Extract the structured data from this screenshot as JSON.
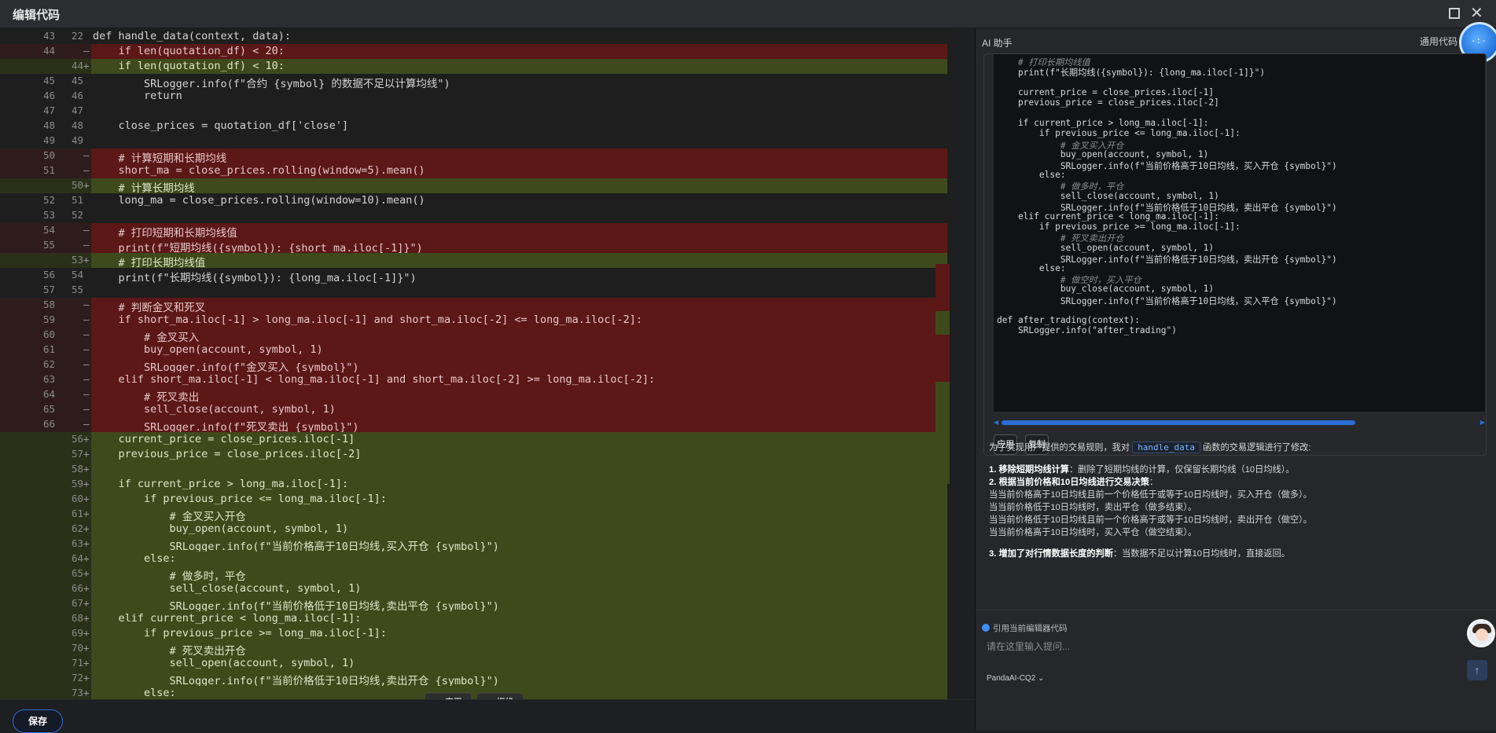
{
  "window": {
    "title": "编辑代码"
  },
  "editor": {
    "rows": [
      {
        "t": "ctx",
        "l1": "43",
        "l2": "22",
        "m": "",
        "c": "def handle_data(context, data):"
      },
      {
        "t": "del",
        "l1": "44",
        "l2": "",
        "m": "—",
        "c": "    if len(quotation_df) < 20:"
      },
      {
        "t": "add",
        "l1": "",
        "l2": "44",
        "m": "+",
        "c": "    if len(quotation_df) < 10:"
      },
      {
        "t": "ctx",
        "l1": "45",
        "l2": "45",
        "m": "",
        "c": "        SRLogger.info(f\"合约 {symbol} 的数据不足以计算均线\")"
      },
      {
        "t": "ctx",
        "l1": "46",
        "l2": "46",
        "m": "",
        "c": "        return"
      },
      {
        "t": "ctx",
        "l1": "47",
        "l2": "47",
        "m": "",
        "c": ""
      },
      {
        "t": "ctx",
        "l1": "48",
        "l2": "48",
        "m": "",
        "c": "    close_prices = quotation_df['close']"
      },
      {
        "t": "ctx",
        "l1": "49",
        "l2": "49",
        "m": "",
        "c": ""
      },
      {
        "t": "del",
        "l1": "50",
        "l2": "",
        "m": "—",
        "c": "    # 计算短期和长期均线"
      },
      {
        "t": "del",
        "l1": "51",
        "l2": "",
        "m": "—",
        "c": "    short_ma = close_prices.rolling(window=5).mean()"
      },
      {
        "t": "add",
        "l1": "",
        "l2": "50",
        "m": "+",
        "c": "    # 计算长期均线"
      },
      {
        "t": "ctx",
        "l1": "52",
        "l2": "51",
        "m": "",
        "c": "    long_ma = close_prices.rolling(window=10).mean()"
      },
      {
        "t": "ctx",
        "l1": "53",
        "l2": "52",
        "m": "",
        "c": ""
      },
      {
        "t": "del",
        "l1": "54",
        "l2": "",
        "m": "—",
        "c": "    # 打印短期和长期均线值"
      },
      {
        "t": "del",
        "l1": "55",
        "l2": "",
        "m": "—",
        "c": "    print(f\"短期均线({symbol}): {short_ma.iloc[-1]}\")"
      },
      {
        "t": "add",
        "l1": "",
        "l2": "53",
        "m": "+",
        "c": "    # 打印长期均线值"
      },
      {
        "t": "ctx",
        "l1": "56",
        "l2": "54",
        "m": "",
        "c": "    print(f\"长期均线({symbol}): {long_ma.iloc[-1]}\")"
      },
      {
        "t": "ctx",
        "l1": "57",
        "l2": "55",
        "m": "",
        "c": ""
      },
      {
        "t": "del",
        "l1": "58",
        "l2": "",
        "m": "—",
        "c": "    # 判断金叉和死叉"
      },
      {
        "t": "del",
        "l1": "59",
        "l2": "",
        "m": "—",
        "c": "    if short_ma.iloc[-1] > long_ma.iloc[-1] and short_ma.iloc[-2] <= long_ma.iloc[-2]:"
      },
      {
        "t": "del",
        "l1": "60",
        "l2": "",
        "m": "—",
        "c": "        # 金叉买入"
      },
      {
        "t": "del",
        "l1": "61",
        "l2": "",
        "m": "—",
        "c": "        buy_open(account, symbol, 1)"
      },
      {
        "t": "del",
        "l1": "62",
        "l2": "",
        "m": "—",
        "c": "        SRLogger.info(f\"金叉买入 {symbol}\")"
      },
      {
        "t": "del",
        "l1": "63",
        "l2": "",
        "m": "—",
        "c": "    elif short_ma.iloc[-1] < long_ma.iloc[-1] and short_ma.iloc[-2] >= long_ma.iloc[-2]:"
      },
      {
        "t": "del",
        "l1": "64",
        "l2": "",
        "m": "—",
        "c": "        # 死叉卖出"
      },
      {
        "t": "del",
        "l1": "65",
        "l2": "",
        "m": "—",
        "c": "        sell_close(account, symbol, 1)"
      },
      {
        "t": "del",
        "l1": "66",
        "l2": "",
        "m": "—",
        "c": "        SRLogger.info(f\"死叉卖出 {symbol}\")"
      },
      {
        "t": "add",
        "l1": "",
        "l2": "56",
        "m": "+",
        "c": "    current_price = close_prices.iloc[-1]"
      },
      {
        "t": "add",
        "l1": "",
        "l2": "57",
        "m": "+",
        "c": "    previous_price = close_prices.iloc[-2]"
      },
      {
        "t": "add",
        "l1": "",
        "l2": "58",
        "m": "+",
        "c": ""
      },
      {
        "t": "add",
        "l1": "",
        "l2": "59",
        "m": "+",
        "c": "    if current_price > long_ma.iloc[-1]:"
      },
      {
        "t": "add",
        "l1": "",
        "l2": "60",
        "m": "+",
        "c": "        if previous_price <= long_ma.iloc[-1]:"
      },
      {
        "t": "add",
        "l1": "",
        "l2": "61",
        "m": "+",
        "c": "            # 金叉买入开仓"
      },
      {
        "t": "add",
        "l1": "",
        "l2": "62",
        "m": "+",
        "c": "            buy_open(account, symbol, 1)"
      },
      {
        "t": "add",
        "l1": "",
        "l2": "63",
        "m": "+",
        "c": "            SRLogger.info(f\"当前价格高于10日均线,买入开仓 {symbol}\")"
      },
      {
        "t": "add",
        "l1": "",
        "l2": "64",
        "m": "+",
        "c": "        else:"
      },
      {
        "t": "add",
        "l1": "",
        "l2": "65",
        "m": "+",
        "c": "            # 做多时，平仓"
      },
      {
        "t": "add",
        "l1": "",
        "l2": "66",
        "m": "+",
        "c": "            sell_close(account, symbol, 1)"
      },
      {
        "t": "add",
        "l1": "",
        "l2": "67",
        "m": "+",
        "c": "            SRLogger.info(f\"当前价格低于10日均线,卖出平仓 {symbol}\")"
      },
      {
        "t": "add",
        "l1": "",
        "l2": "68",
        "m": "+",
        "c": "    elif current_price < long_ma.iloc[-1]:"
      },
      {
        "t": "add",
        "l1": "",
        "l2": "69",
        "m": "+",
        "c": "        if previous_price >= long_ma.iloc[-1]:"
      },
      {
        "t": "add",
        "l1": "",
        "l2": "70",
        "m": "+",
        "c": "            # 死叉卖出开仓"
      },
      {
        "t": "add",
        "l1": "",
        "l2": "71",
        "m": "+",
        "c": "            sell_open(account, symbol, 1)"
      },
      {
        "t": "add",
        "l1": "",
        "l2": "72",
        "m": "+",
        "c": "            SRLogger.info(f\"当前价格低于10日均线,卖出开仓 {symbol}\")"
      },
      {
        "t": "add",
        "l1": "",
        "l2": "73",
        "m": "+",
        "c": "        else:"
      }
    ],
    "accept_label": "✓ 应用",
    "reject_label": "✕ 拒绝"
  },
  "bottom": {
    "save_label": "保存"
  },
  "ai": {
    "title": "AI 助手",
    "header_right": "通用代码",
    "avatar_text": "-:-",
    "code_lines": [
      {
        "c": "    # 打印长期均线值",
        "k": "cmt"
      },
      {
        "c": "    print(f\"长期均线({symbol}): {long_ma.iloc[-1]}\")",
        "k": ""
      },
      {
        "c": "",
        "k": ""
      },
      {
        "c": "    current_price = close_prices.iloc[-1]",
        "k": ""
      },
      {
        "c": "    previous_price = close_prices.iloc[-2]",
        "k": ""
      },
      {
        "c": "",
        "k": ""
      },
      {
        "c": "    if current_price > long_ma.iloc[-1]:",
        "k": ""
      },
      {
        "c": "        if previous_price <= long_ma.iloc[-1]:",
        "k": ""
      },
      {
        "c": "            # 金叉买入开仓",
        "k": "cmt"
      },
      {
        "c": "            buy_open(account, symbol, 1)",
        "k": ""
      },
      {
        "c": "            SRLogger.info(f\"当前价格高于10日均线，买入开仓 {symbol}\")",
        "k": ""
      },
      {
        "c": "        else:",
        "k": ""
      },
      {
        "c": "            # 做多时，平仓",
        "k": "cmt"
      },
      {
        "c": "            sell_close(account, symbol, 1)",
        "k": ""
      },
      {
        "c": "            SRLogger.info(f\"当前价格低于10日均线，卖出平仓 {symbol}\")",
        "k": ""
      },
      {
        "c": "    elif current_price < long_ma.iloc[-1]:",
        "k": ""
      },
      {
        "c": "        if previous_price >= long_ma.iloc[-1]:",
        "k": ""
      },
      {
        "c": "            # 死叉卖出开仓",
        "k": "cmt"
      },
      {
        "c": "            sell_open(account, symbol, 1)",
        "k": ""
      },
      {
        "c": "            SRLogger.info(f\"当前价格低于10日均线，卖出开仓 {symbol}\")",
        "k": ""
      },
      {
        "c": "        else:",
        "k": ""
      },
      {
        "c": "            # 做空时，买入平仓",
        "k": "cmt"
      },
      {
        "c": "            buy_close(account, symbol, 1)",
        "k": ""
      },
      {
        "c": "            SRLogger.info(f\"当前价格高于10日均线，买入平仓 {symbol}\")",
        "k": ""
      },
      {
        "c": "",
        "k": ""
      },
      {
        "c": "def after_trading(context):",
        "k": ""
      },
      {
        "c": "    SRLogger.info(\"after_trading\")",
        "k": ""
      }
    ],
    "apply_label": "应用",
    "copy_label": "复制",
    "desc_intro_pre": "为了实现用户提供的交易规则，我对",
    "desc_tag": "handle_data",
    "desc_intro_post": "函数的交易逻辑进行了修改:",
    "desc_1_bold": "1. 移除短期均线计算",
    "desc_1_rest": "：删除了短期均线的计算，仅保留长期均线（10日均线）。",
    "desc_2_bold": "2. 根据当前价格和10日均线进行交易决策",
    "desc_2_rest": "：",
    "desc_2_lines": [
      "当当前价格高于10日均线且前一个价格低于或等于10日均线时，买入开仓（做多）。",
      "当当前价格低于10日均线时，卖出平仓（做多结束）。",
      "当当前价格低于10日均线且前一个价格高于或等于10日均线时，卖出开仓（做空）。",
      "当当前价格高于10日均线时，买入平仓（做空结束）。"
    ],
    "desc_3_bold": "3. 增加了对行情数据长度的判断",
    "desc_3_rest": "：当数据不足以计算10日均线时，直接返回。",
    "quote_label": "引用当前编辑器代码",
    "prompt_placeholder": "请在这里输入提问...",
    "model_label": "PandaAI-CQ2 ⌄",
    "send_icon": "↑"
  }
}
